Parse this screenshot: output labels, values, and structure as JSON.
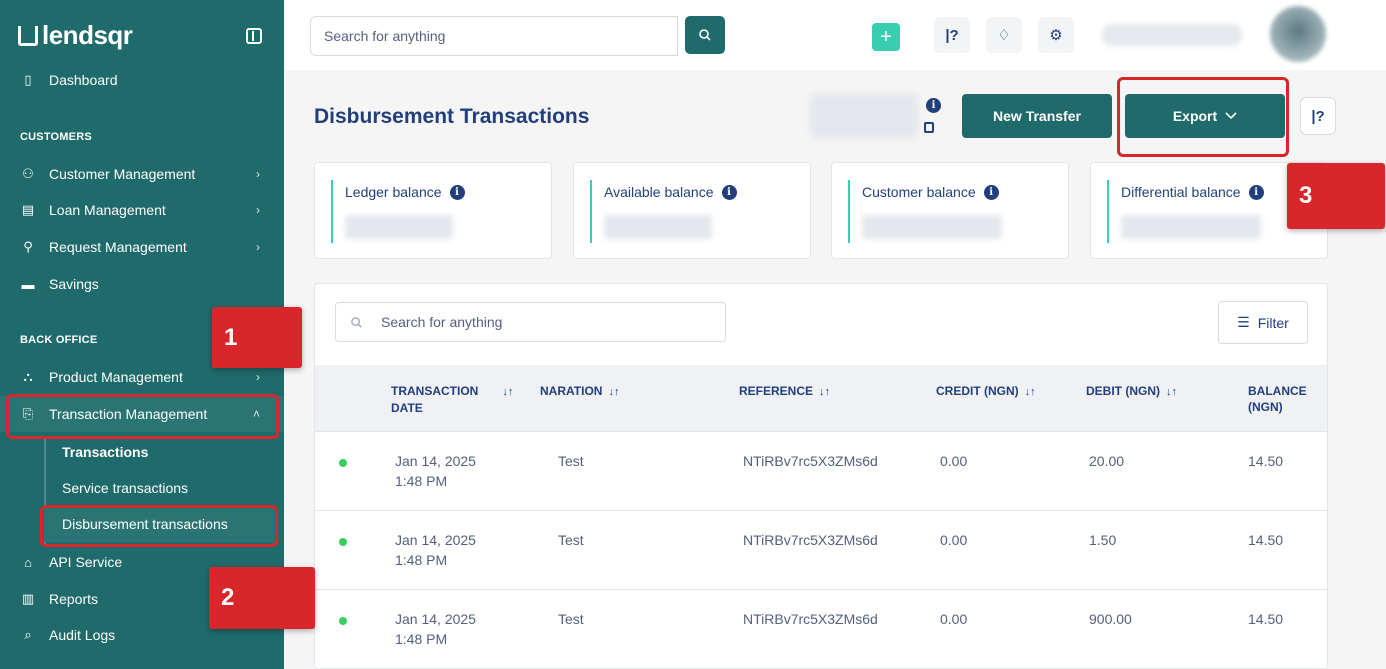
{
  "brand": {
    "name": "lendsqr"
  },
  "sidebar": {
    "dashboard": "Dashboard",
    "customers_section": "CUSTOMERS",
    "customers_items": [
      "Customer Management",
      "Loan Management",
      "Request Management",
      "Savings"
    ],
    "back_office_section": "BACK OFFICE",
    "product_management": "Product Management",
    "transaction_management": "Transaction Management",
    "sub_items": [
      "Transactions",
      "Service transactions",
      "Disbursement transactions"
    ],
    "more_items": [
      "API Service",
      "Reports",
      "Audit Logs"
    ]
  },
  "annotations": {
    "one": "1",
    "two": "2",
    "three": "3"
  },
  "topbar": {
    "search_placeholder": "Search for anything"
  },
  "page": {
    "title": "Disbursement Transactions",
    "new_transfer": "New Transfer",
    "export": "Export"
  },
  "balances": [
    "Ledger balance",
    "Available balance",
    "Customer balance",
    "Differential balance"
  ],
  "table": {
    "search_placeholder": "Search for anything",
    "filter": "Filter",
    "headers": {
      "date_l1": "TRANSACTION",
      "date_l2": "DATE",
      "naration": "NARATION",
      "reference": "REFERENCE",
      "credit": "CREDIT (NGN)",
      "debit": "DEBIT (NGN)",
      "balance_l1": "BALANCE",
      "balance_l2": "(NGN)"
    },
    "rows": [
      {
        "date": "Jan 14, 2025",
        "time": "1:48 PM",
        "naration": "Test",
        "reference": "NTiRBv7rc5X3ZMs6d",
        "credit": "0.00",
        "debit": "20.00",
        "balance": "14.50"
      },
      {
        "date": "Jan 14, 2025",
        "time": "1:48 PM",
        "naration": "Test",
        "reference": "NTiRBv7rc5X3ZMs6d",
        "credit": "0.00",
        "debit": "1.50",
        "balance": "14.50"
      },
      {
        "date": "Jan 14, 2025",
        "time": "1:48 PM",
        "naration": "Test",
        "reference": "NTiRBv7rc5X3ZMs6d",
        "credit": "0.00",
        "debit": "900.00",
        "balance": "14.50"
      }
    ]
  },
  "colors": {
    "sidebar": "#1f6a6a",
    "accent": "#39cdb1",
    "annotation": "#d9262b",
    "status_dot": "#39cd62"
  }
}
